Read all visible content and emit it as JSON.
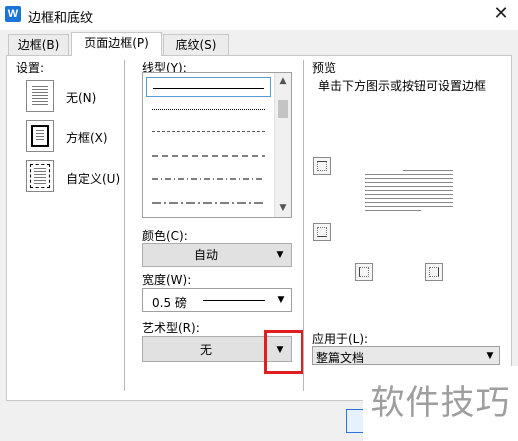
{
  "window": {
    "title": "边框和底纹",
    "app_icon_letter": "W",
    "close_glyph": "✕"
  },
  "tabs": [
    {
      "label": "边框(B)"
    },
    {
      "label": "页面边框(P)",
      "active": true
    },
    {
      "label": "底纹(S)"
    }
  ],
  "settings": {
    "label": "设置:",
    "items": [
      {
        "label": "无(N)",
        "icon": "none-border-icon"
      },
      {
        "label": "方框(X)",
        "icon": "box-border-icon"
      },
      {
        "label": "自定义(U)",
        "icon": "custom-border-icon"
      }
    ]
  },
  "line_style": {
    "label": "线型(Y):",
    "items": [
      "solid",
      "dotted",
      "fine-dashed",
      "dashed",
      "dash-dot",
      "long-dash"
    ],
    "selected": "solid"
  },
  "color": {
    "label": "颜色(C):",
    "value": "自动"
  },
  "width": {
    "label": "宽度(W):",
    "value": "0.5 磅"
  },
  "art": {
    "label": "艺术型(R):",
    "value": "无"
  },
  "preview": {
    "label": "预览",
    "hint": "单击下方图示或按钮可设置边框"
  },
  "apply_to": {
    "label": "应用于(L):",
    "value": "整篇文档"
  },
  "watermark": "软件技巧",
  "colors": {
    "accent": "#1a74d8",
    "highlight": "#e02020"
  },
  "icons": {
    "dropdown": "▼",
    "scroll_up": "▲",
    "scroll_down": "▼"
  }
}
